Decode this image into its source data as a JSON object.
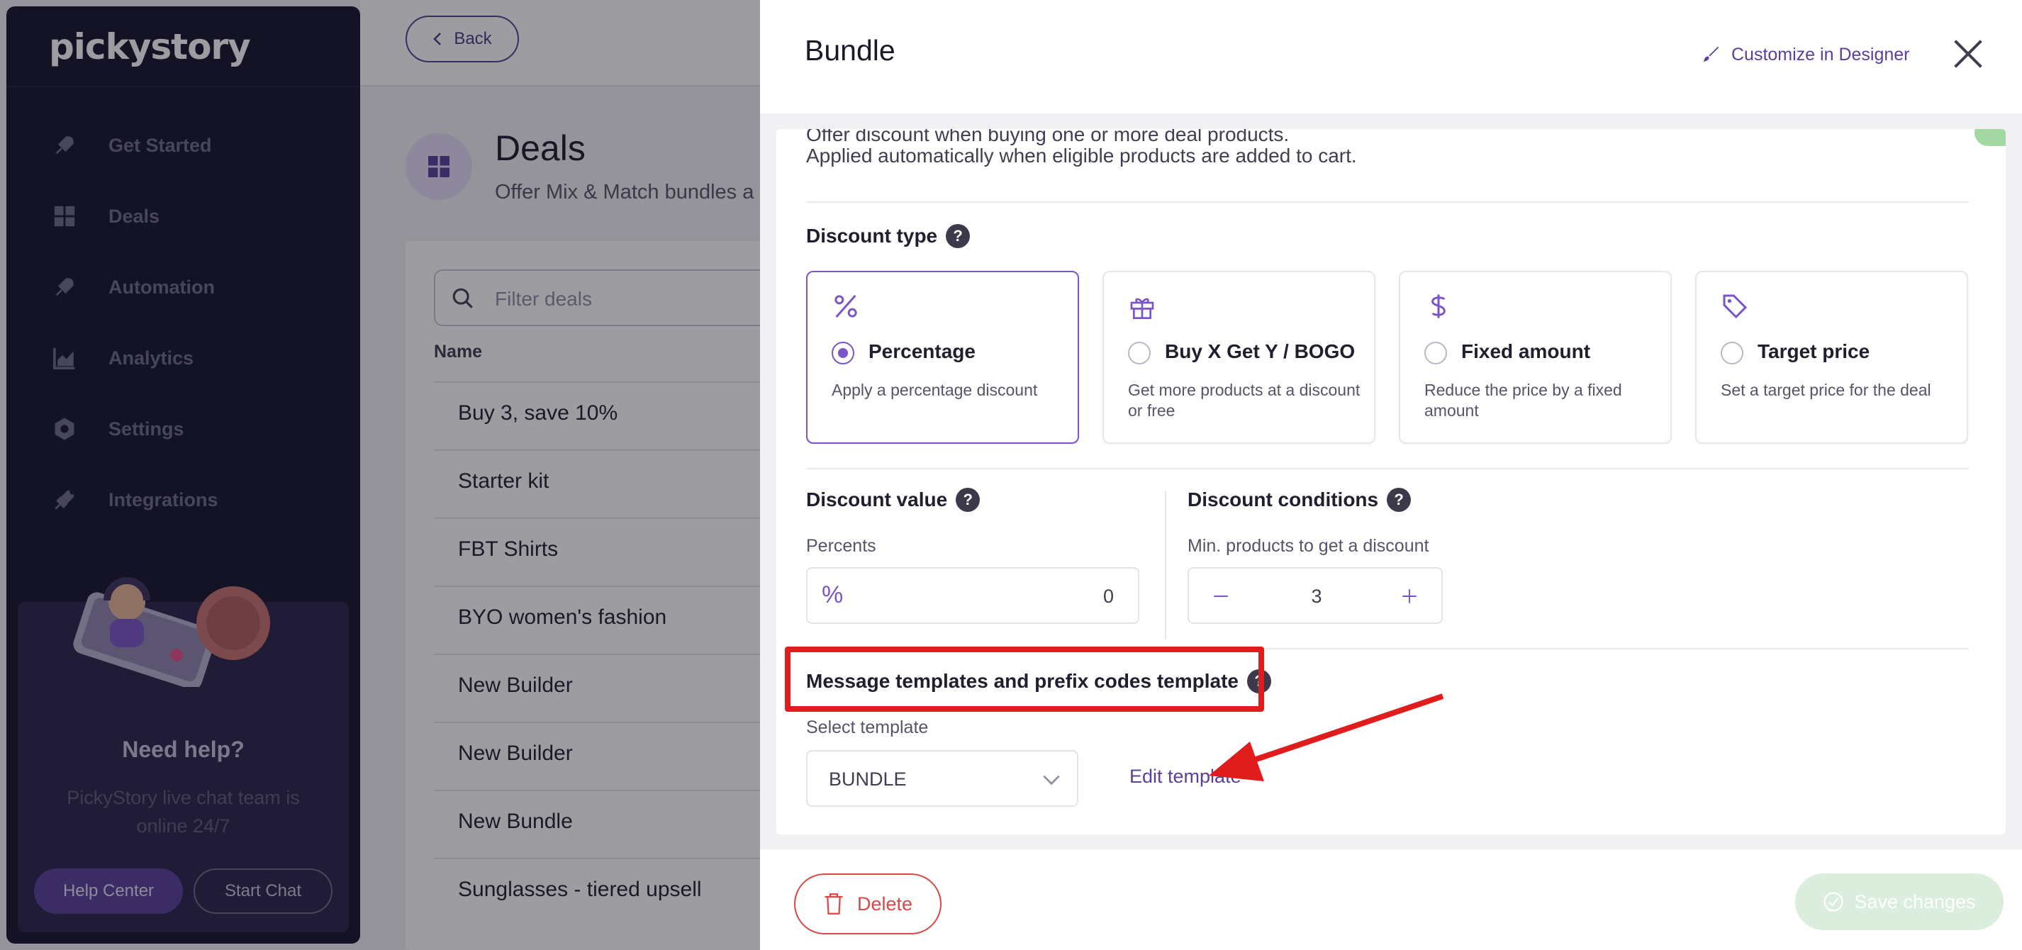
{
  "sidebar": {
    "logo": "pickystory",
    "items": [
      {
        "label": "Get Started",
        "icon": "rocket-icon"
      },
      {
        "label": "Deals",
        "icon": "grid-icon"
      },
      {
        "label": "Automation",
        "icon": "rocket-icon"
      },
      {
        "label": "Analytics",
        "icon": "chart-icon"
      },
      {
        "label": "Settings",
        "icon": "gear-icon"
      },
      {
        "label": "Integrations",
        "icon": "plug-icon"
      }
    ],
    "help": {
      "title": "Need help?",
      "subtitle": "PickyStory live chat team is online 24/7",
      "help_center": "Help Center",
      "start_chat": "Start Chat"
    }
  },
  "main": {
    "back_label": "Back",
    "title": "Deals",
    "subtitle": "Offer Mix & Match bundles a",
    "filter_placeholder": "Filter deals",
    "name_header": "Name",
    "rows": [
      "Buy 3, save 10%",
      "Starter kit",
      "FBT Shirts",
      "BYO women's fashion",
      "New Builder",
      "New Builder",
      "New Bundle",
      "Sunglasses - tiered upsell"
    ]
  },
  "drawer": {
    "title": "Bundle",
    "customize_label": "Customize in Designer",
    "offer_line1": "Offer discount when buying one or more deal products.",
    "offer_line2": "Applied automatically when eligible products are added to cart.",
    "discount_type_label": "Discount type",
    "options": [
      {
        "title": "Percentage",
        "desc": "Apply a percentage discount",
        "icon": "percent-icon",
        "selected": true
      },
      {
        "title": "Buy X Get Y / BOGO",
        "desc": "Get more products at a discount or free",
        "icon": "gift-icon",
        "selected": false
      },
      {
        "title": "Fixed amount",
        "desc": "Reduce the price by a fixed amount",
        "icon": "dollar-icon",
        "selected": false
      },
      {
        "title": "Target price",
        "desc": "Set a target price for the deal",
        "icon": "tag-icon",
        "selected": false
      }
    ],
    "discount_value_label": "Discount value",
    "percents_label": "Percents",
    "percent_symbol": "%",
    "percent_value": "0",
    "discount_conditions_label": "Discount conditions",
    "min_products_label": "Min. products to get a discount",
    "min_products_value": "3",
    "message_templates_label": "Message templates and prefix codes template",
    "select_template_label": "Select template",
    "template_value": "BUNDLE",
    "edit_template_label": "Edit template",
    "help_mark": "?",
    "delete_label": "Delete",
    "save_label": "Save changes"
  },
  "colors": {
    "accent": "#7a55c8",
    "annotation_red": "#e11c1c",
    "sidebar_bg": "#16132c"
  }
}
